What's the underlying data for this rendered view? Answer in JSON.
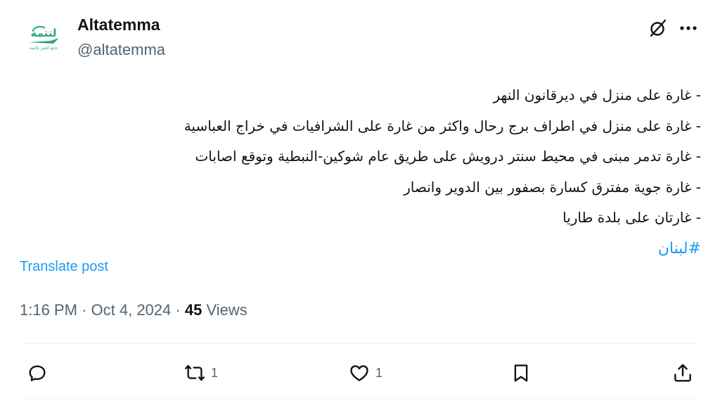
{
  "author": {
    "display_name": "Altatemma",
    "handle": "@altatemma",
    "avatar_text": "لتتمة",
    "avatar_subtext": "تتابع الخبر بالتمة"
  },
  "header_icons": [
    "grok-icon",
    "more-icon"
  ],
  "tweet": {
    "lines": [
      "- غارة على منزل في ديرقانون النهر",
      "- غارة على منزل في اطراف برج رحال واكثر من غارة على الشرافيات في خراج العباسية",
      "- غارة تدمر مبنى في محيط سنتر درويش على طريق عام شوكين-النبطية وتوقع اصابات",
      "- غارة جوية مفترق كسارة بصفور بين الدوير وانصار",
      "- غارتان على بلدة طاريا"
    ],
    "hashtag": "#لبنان"
  },
  "translate_label": "Translate post",
  "meta": {
    "time": "1:16 PM",
    "separator": "·",
    "date": "Oct 4, 2024",
    "views_count": "45",
    "views_label": "Views"
  },
  "actions": {
    "reply_count": "",
    "repost_count": "1",
    "like_count": "1"
  },
  "colors": {
    "accent": "#1d9bf0",
    "text": "#0f1419",
    "secondary": "#536471",
    "divider": "#eff3f4",
    "avatar_green": "#2aa876"
  }
}
